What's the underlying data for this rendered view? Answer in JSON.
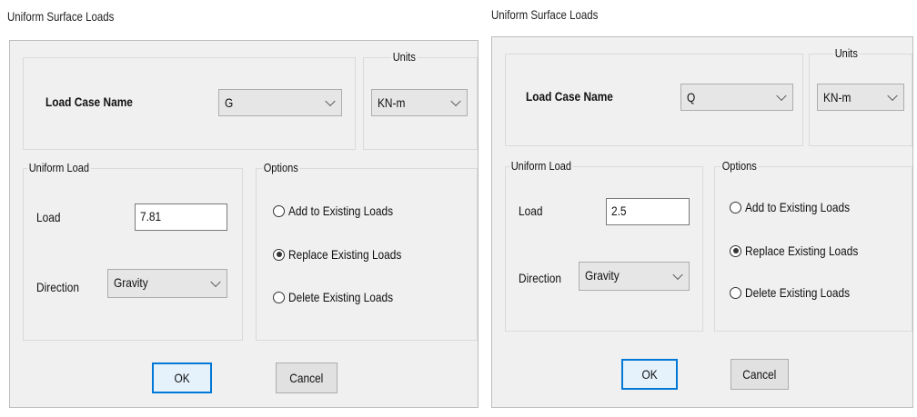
{
  "dialogs": [
    {
      "title": "Uniform Surface Loads",
      "load_case_label": "Load Case Name",
      "load_case_value": "G",
      "units_legend": "Units",
      "units_value": "KN-m",
      "uniform_load_legend": "Uniform Load",
      "load_label": "Load",
      "load_value": "7.81",
      "direction_label": "Direction",
      "direction_value": "Gravity",
      "options_legend": "Options",
      "options": [
        "Add to Existing Loads",
        "Replace Existing Loads",
        "Delete Existing Loads"
      ],
      "selected_option": 1,
      "ok_label": "OK",
      "cancel_label": "Cancel"
    },
    {
      "title": "Uniform Surface Loads",
      "load_case_label": "Load Case Name",
      "load_case_value": "Q",
      "units_legend": "Units",
      "units_value": "KN-m",
      "uniform_load_legend": "Uniform Load",
      "load_label": "Load",
      "load_value": "2.5",
      "direction_label": "Direction",
      "direction_value": "Gravity",
      "options_legend": "Options",
      "options": [
        "Add to Existing Loads",
        "Replace Existing Loads",
        "Delete Existing Loads"
      ],
      "selected_option": 1,
      "ok_label": "OK",
      "cancel_label": "Cancel"
    }
  ],
  "colors": {
    "dialog_bg": "#f0f0f0",
    "default_button_border": "#0078d7"
  }
}
